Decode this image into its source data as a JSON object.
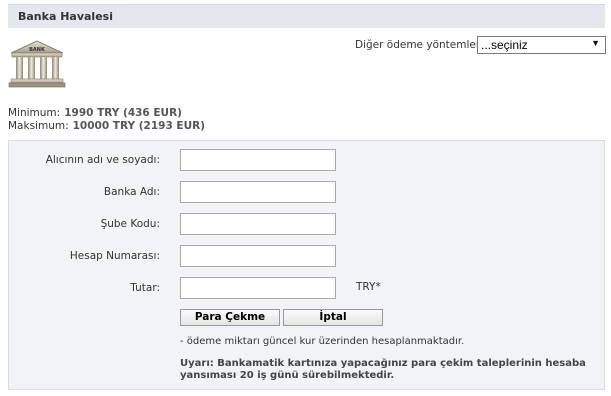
{
  "header": {
    "title": "Banka Havalesi"
  },
  "bank_icon": {
    "label": "BANK"
  },
  "other_methods": {
    "label": "Diğer ödeme yöntemleri",
    "selected": "...seçiniz"
  },
  "limits": {
    "min_label": "Minimum:",
    "min_value": "1990 TRY (436 EUR)",
    "max_label": "Maksimum:",
    "max_value": "10000 TRY (2193 EUR)"
  },
  "form": {
    "fields": [
      {
        "label": "Alıcının adı ve soyadı:",
        "value": ""
      },
      {
        "label": "Banka Adı:",
        "value": ""
      },
      {
        "label": "Şube Kodu:",
        "value": ""
      },
      {
        "label": "Hesap Numarası:",
        "value": ""
      },
      {
        "label": "Tutar:",
        "value": ""
      }
    ],
    "amount_unit": "TRY*",
    "submit_label": "Para Çekme",
    "cancel_label": "İptal",
    "note": "- ödeme miktarı güncel kur üzerinden hesaplanmaktadır.",
    "warning": "Uyarı: Bankamatik kartınıza yapacağınız para çekim taleplerinin hesaba yansıması 20 iş günü sürebilmektedir."
  }
}
